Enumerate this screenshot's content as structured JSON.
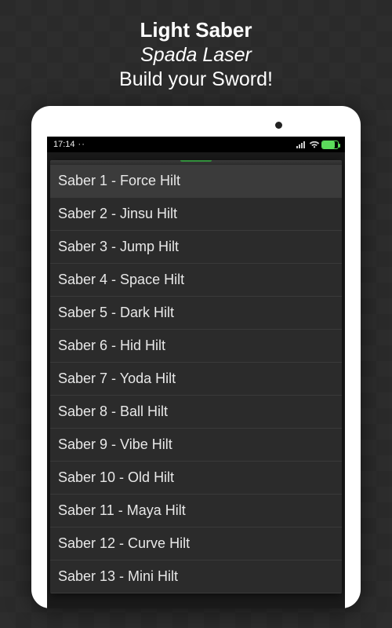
{
  "header": {
    "line1": "Light Saber",
    "line2": "Spada Laser",
    "line3": "Build your Sword!"
  },
  "statusbar": {
    "time": "17:14"
  },
  "saber_list": [
    "Saber 1 - Force Hilt",
    "Saber 2 - Jinsu Hilt",
    "Saber 3 - Jump Hilt",
    "Saber 4 - Space Hilt",
    "Saber 5 - Dark Hilt",
    "Saber 6 - Hid Hilt",
    "Saber 7 - Yoda Hilt",
    "Saber 8 - Ball Hilt",
    "Saber 9 - Vibe Hilt",
    "Saber 10 - Old Hilt",
    "Saber 11 - Maya Hilt",
    "Saber 12 - Curve Hilt",
    "Saber 13 - Mini Hilt"
  ],
  "selected_index": 0
}
